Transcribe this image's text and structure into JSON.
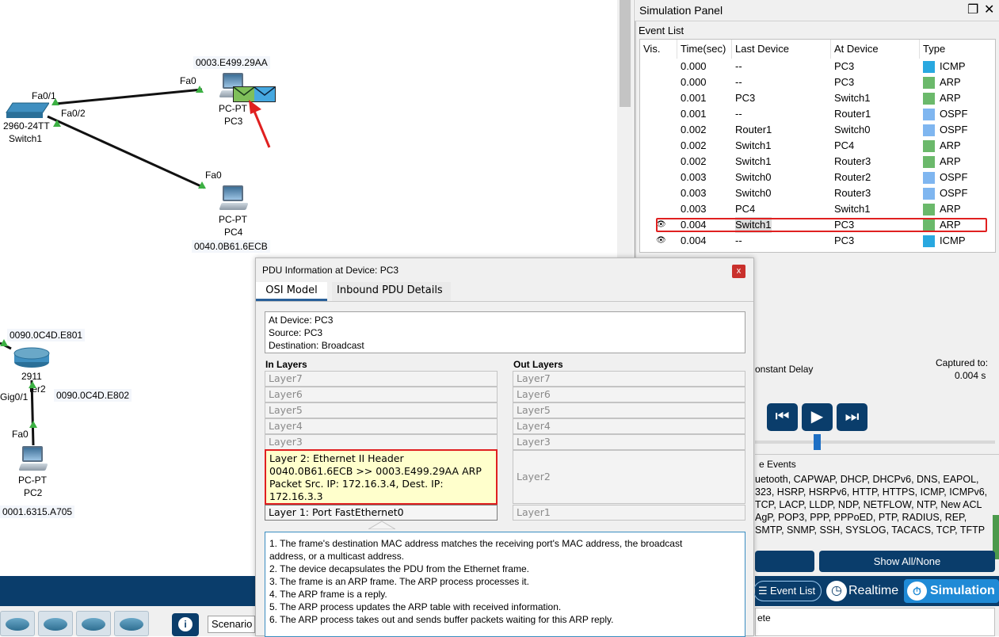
{
  "topology": {
    "pc3": {
      "mac": "0003.E499.29AA",
      "type": "PC-PT",
      "name": "PC3",
      "port": "Fa0"
    },
    "pc4": {
      "mac": "0040.0B61.6ECB",
      "type": "PC-PT",
      "name": "PC4",
      "port": "Fa0"
    },
    "switch1": {
      "model": "2960-24TT",
      "name": "Switch1",
      "port_a": "Fa0/1",
      "port_b": "Fa0/2"
    },
    "router2": {
      "mac_a": "0090.0C4D.E801",
      "mac_b": "0090.0C4D.E802",
      "model": "2911",
      "name_fragment": "ter2",
      "port": "Gig0/1"
    },
    "pc2": {
      "mac": "0001.6315.A705",
      "type": "PC-PT",
      "name": "PC2",
      "port": "Fa0"
    }
  },
  "sim_panel": {
    "title": "Simulation Panel",
    "event_list_label": "Event List",
    "columns": [
      "Vis.",
      "Time(sec)",
      "Last Device",
      "At Device",
      "Type"
    ],
    "events": [
      {
        "vis": "",
        "time": "0.000",
        "last": "--",
        "at": "PC3",
        "type": "ICMP",
        "color": "#29a8e0"
      },
      {
        "vis": "",
        "time": "0.000",
        "last": "--",
        "at": "PC3",
        "type": "ARP",
        "color": "#6bb96b"
      },
      {
        "vis": "",
        "time": "0.001",
        "last": "PC3",
        "at": "Switch1",
        "type": "ARP",
        "color": "#6bb96b"
      },
      {
        "vis": "",
        "time": "0.001",
        "last": "--",
        "at": "Router1",
        "type": "OSPF",
        "color": "#7fb6f0"
      },
      {
        "vis": "",
        "time": "0.002",
        "last": "Router1",
        "at": "Switch0",
        "type": "OSPF",
        "color": "#7fb6f0"
      },
      {
        "vis": "",
        "time": "0.002",
        "last": "Switch1",
        "at": "PC4",
        "type": "ARP",
        "color": "#6bb96b"
      },
      {
        "vis": "",
        "time": "0.002",
        "last": "Switch1",
        "at": "Router3",
        "type": "ARP",
        "color": "#6bb96b"
      },
      {
        "vis": "",
        "time": "0.003",
        "last": "Switch0",
        "at": "Router2",
        "type": "OSPF",
        "color": "#7fb6f0"
      },
      {
        "vis": "",
        "time": "0.003",
        "last": "Switch0",
        "at": "Router3",
        "type": "OSPF",
        "color": "#7fb6f0"
      },
      {
        "vis": "",
        "time": "0.003",
        "last": "PC4",
        "at": "Switch1",
        "type": "ARP",
        "color": "#6bb96b"
      },
      {
        "vis": "eye",
        "time": "0.004",
        "last": "Switch1",
        "at": "PC3",
        "type": "ARP",
        "color": "#6bb96b"
      },
      {
        "vis": "eye",
        "time": "0.004",
        "last": "--",
        "at": "PC3",
        "type": "ICMP",
        "color": "#29a8e0"
      }
    ],
    "constant_delay_fragment": "onstant Delay",
    "captured_to_label": "Captured to:",
    "captured_to_value": "0.004 s",
    "events_fragment": "e Events",
    "protocol_lines": [
      "uetooth, CAPWAP, DHCP, DHCPv6, DNS, EAPOL,",
      "323, HSRP, HSRPv6, HTTP, HTTPS, ICMP, ICMPv6,",
      "TCP, LACP, LLDP, NDP, NETFLOW, NTP, New ACL",
      "AgP, POP3, PPP, PPPoED, PTP, RADIUS, REP,",
      "SMTP, SNMP, SSH, SYSLOG, TACACS, TCP, TFTP"
    ],
    "show_all_label": "Show All/None",
    "mode_buttons": {
      "event_list": "Event List",
      "realtime": "Realtime",
      "simulation": "Simulation"
    },
    "bottom_fragment": "ete"
  },
  "pdu": {
    "title": "PDU Information at Device: PC3",
    "close_glyph": "x",
    "tabs": [
      "OSI Model",
      "Inbound PDU Details"
    ],
    "info_lines": [
      "At Device: PC3",
      "Source: PC3",
      "Destination: Broadcast"
    ],
    "in_header": "In Layers",
    "out_header": "Out Layers",
    "in_layers": [
      "Layer7",
      "Layer6",
      "Layer5",
      "Layer4",
      "Layer3"
    ],
    "out_layers": [
      "Layer7",
      "Layer6",
      "Layer5",
      "Layer4",
      "Layer3"
    ],
    "layer2_in_lines": [
      "Layer 2: Ethernet II Header",
      "0040.0B61.6ECB >> 0003.E499.29AA ARP",
      "Packet Src. IP: 172.16.3.4, Dest. IP:",
      "172.16.3.3"
    ],
    "layer2_out": "Layer2",
    "layer1_in": "Layer 1: Port FastEthernet0",
    "layer1_out": "Layer1",
    "description": [
      "1. The frame's destination MAC address matches the receiving port's MAC address, the broadcast",
      "address, or a multicast address.",
      "2. The device decapsulates the PDU from the Ethernet frame.",
      "3. The frame is an ARP frame. The ARP process processes it.",
      "4. The ARP frame is a reply.",
      "5. The ARP process updates the ARP table with received information.",
      "6. The ARP process takes out and sends buffer packets waiting for this ARP reply."
    ]
  },
  "bottom": {
    "scenario_label": "Scenario",
    "info_glyph": "i"
  }
}
